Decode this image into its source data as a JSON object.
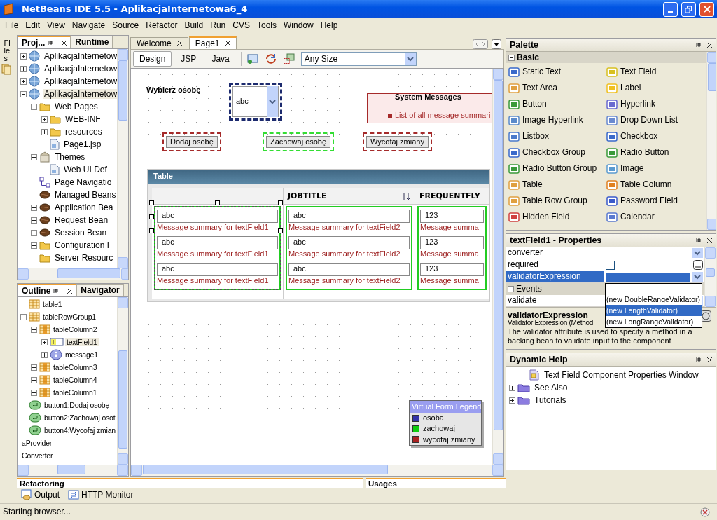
{
  "window": {
    "title": "NetBeans IDE 5.5 - AplikacjaInternetowa6_4"
  },
  "menu": [
    "File",
    "Edit",
    "View",
    "Navigate",
    "Source",
    "Refactor",
    "Build",
    "Run",
    "CVS",
    "Tools",
    "Window",
    "Help"
  ],
  "side_strip": {
    "label": "Files"
  },
  "projects": {
    "tabs": [
      {
        "label": "Proj...",
        "selected": true
      },
      {
        "label": "Runtime",
        "selected": false
      }
    ],
    "tree": [
      {
        "label": "AplikacjaInternetow",
        "kind": "project",
        "expanded": false
      },
      {
        "label": "AplikacjaInternetow",
        "kind": "project",
        "expanded": false
      },
      {
        "label": "AplikacjaInternetow",
        "kind": "project",
        "expanded": false
      },
      {
        "label": "AplikacjaInternetow",
        "kind": "project",
        "expanded": true,
        "selected": true,
        "children": [
          {
            "label": "Web Pages",
            "kind": "folder",
            "expanded": true,
            "children": [
              {
                "label": "WEB-INF",
                "kind": "folder",
                "expanded": false
              },
              {
                "label": "resources",
                "kind": "folder",
                "expanded": false
              },
              {
                "label": "Page1.jsp",
                "kind": "file"
              }
            ]
          },
          {
            "label": "Themes",
            "kind": "package",
            "expanded": true,
            "children": [
              {
                "label": "Web UI Def",
                "kind": "file"
              }
            ]
          },
          {
            "label": "Page Navigatio",
            "kind": "diagram"
          },
          {
            "label": "Managed Beans",
            "kind": "bean"
          },
          {
            "label": "Application Bea",
            "kind": "bean",
            "expanded": false
          },
          {
            "label": "Request Bean",
            "kind": "bean",
            "expanded": false
          },
          {
            "label": "Session Bean",
            "kind": "bean",
            "expanded": false
          },
          {
            "label": "Configuration F",
            "kind": "folder",
            "expanded": false
          },
          {
            "label": "Server Resourc",
            "kind": "folder"
          }
        ]
      }
    ]
  },
  "outline": {
    "tabs": [
      {
        "label": "Outline",
        "selected": true
      },
      {
        "label": "Navigator",
        "selected": false
      }
    ],
    "tree": [
      {
        "label": "table1",
        "kind": "table"
      },
      {
        "label": "tableRowGroup1",
        "kind": "table",
        "expanded": true,
        "children": [
          {
            "label": "tableColumn2",
            "kind": "column",
            "expanded": true,
            "children": [
              {
                "label": "textField1",
                "kind": "field",
                "expanded": false,
                "selected": true
              },
              {
                "label": "message1",
                "kind": "message",
                "expanded": false,
                "selected": false
              }
            ]
          },
          {
            "label": "tableColumn3",
            "kind": "column",
            "expanded": false
          },
          {
            "label": "tableColumn4",
            "kind": "column",
            "expanded": false
          },
          {
            "label": "tableColumn1",
            "kind": "column",
            "expanded": false
          }
        ]
      },
      {
        "label": "button1:Dodaj osobę",
        "kind": "button"
      },
      {
        "label": "button2:Zachowaj osot",
        "kind": "button"
      },
      {
        "label": "button4:Wycofaj zmian",
        "kind": "button"
      },
      {
        "label": "aProvider"
      },
      {
        "label": "Converter"
      }
    ]
  },
  "editor": {
    "tabs": [
      {
        "label": "Welcome",
        "selected": false
      },
      {
        "label": "Page1",
        "selected": true
      }
    ],
    "views": [
      {
        "label": "Design",
        "selected": true
      },
      {
        "label": "JSP",
        "selected": false
      },
      {
        "label": "Java",
        "selected": false
      }
    ],
    "size_select": {
      "value": "Any Size"
    },
    "canvas": {
      "label": "Wybierz osobę",
      "dropdown": {
        "value": "abc",
        "color": "#1c2a6e"
      },
      "messages": {
        "title": "System Messages",
        "item": "List of all message summari"
      },
      "buttons": [
        {
          "label": "Dodaj osobę",
          "color": "#a52a2a"
        },
        {
          "label": "Zachowaj osobę",
          "color": "#33dd33"
        },
        {
          "label": "Wycofaj zmiany",
          "color": "#a52a2a"
        }
      ],
      "table": {
        "title": "Table",
        "columns": [
          {
            "selected": true,
            "color": "#22cc22",
            "cells": [
              {
                "value": "abc",
                "message": "Message summary for textField1"
              },
              {
                "value": "abc",
                "message": "Message summary for textField1"
              },
              {
                "value": "abc",
                "message": "Message summary for textField1"
              }
            ]
          },
          {
            "header": "JOBTITLE",
            "sortable": true,
            "selected": false,
            "color": "#22cc22",
            "cells": [
              {
                "value": "abc",
                "message": "Message summary for textField2"
              },
              {
                "value": "abc",
                "message": "Message summary for textField2"
              },
              {
                "value": "abc",
                "message": "Message summary for textField2"
              }
            ]
          },
          {
            "header": "FREQUENTFLY",
            "selected": false,
            "color": "#22cc22",
            "cells": [
              {
                "value": "123",
                "message": "Message summa"
              },
              {
                "value": "123",
                "message": "Message summa"
              },
              {
                "value": "123",
                "message": "Message summa"
              }
            ]
          }
        ]
      },
      "legend": {
        "title": "Virtual Form Legend",
        "items": [
          {
            "label": "osoba",
            "color": "#3333aa"
          },
          {
            "label": "zachowaj",
            "color": "#11cc11"
          },
          {
            "label": "wycofaj zmiany",
            "color": "#aa2222"
          }
        ]
      }
    }
  },
  "palette": {
    "title": "Palette",
    "category": {
      "label": "Basic",
      "expanded": true
    },
    "items": [
      "Static Text",
      "Text Field",
      "Text Area",
      "Label",
      "Button",
      "Hyperlink",
      "Image Hyperlink",
      "Drop Down List",
      "Listbox",
      "Checkbox",
      "Checkbox Group",
      "Radio Button",
      "Radio Button Group",
      "Image",
      "Table",
      "Table Column",
      "Table Row Group",
      "Password Field",
      "Hidden Field",
      "Calendar"
    ]
  },
  "properties": {
    "title": "textField1 - Properties",
    "rows": [
      {
        "name": "converter",
        "kind": "dropdown",
        "selected": false
      },
      {
        "name": "required",
        "kind": "checkbox",
        "checked": false,
        "selected": false
      },
      {
        "name": "validatorExpression",
        "kind": "dropdown",
        "selected": true
      },
      {
        "name": "Events",
        "kind": "section",
        "expanded": true
      },
      {
        "name": "validate",
        "kind": "dropdown",
        "selected": false
      }
    ],
    "popup": [
      {
        "label": "(new DoubleRangeValidator)",
        "selected": false
      },
      {
        "label": "(new LengthValidator)",
        "selected": true
      },
      {
        "label": "(new LongRangeValidator)",
        "selected": false
      }
    ],
    "description": {
      "title": "validatorExpression",
      "subtitle": "Validator Expression (Method",
      "text": "The validator attribute is used to specify a method in a backing bean to  validate input to the component"
    }
  },
  "dynamic_help": {
    "title": "Dynamic Help",
    "tree": [
      {
        "label": "Text Field Component Properties Window",
        "kind": "help"
      },
      {
        "label": "See Also",
        "kind": "helpfolder",
        "expanded": false
      },
      {
        "label": "Tutorials",
        "kind": "helpfolder",
        "expanded": false
      }
    ]
  },
  "bottom": {
    "tabs": [
      "Refactoring",
      "Usages"
    ],
    "buttons": [
      "Output",
      "HTTP Monitor"
    ]
  },
  "status_bar": {
    "text": "Starting browser..."
  }
}
